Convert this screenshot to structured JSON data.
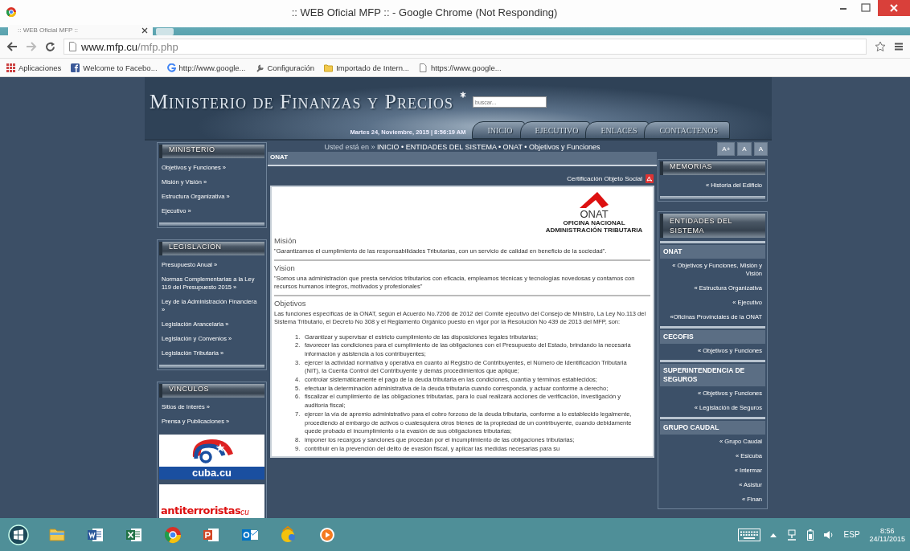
{
  "window": {
    "title": ":: WEB Oficial MFP :: - Google Chrome (Not Responding)"
  },
  "tabs": [
    {
      "label": ":: WEB Oficial MFP ::",
      "selected": true
    }
  ],
  "address": {
    "host": "www.mfp.cu",
    "path": "/mfp.php"
  },
  "bookmarks": [
    {
      "label": "Aplicaciones",
      "kind": "apps"
    },
    {
      "label": "Welcome to Facebo...",
      "kind": "facebook"
    },
    {
      "label": "http://www.google...",
      "kind": "google"
    },
    {
      "label": "Configuración",
      "kind": "tool"
    },
    {
      "label": "Importado de Intern...",
      "kind": "folder"
    },
    {
      "label": "https://www.google...",
      "kind": "page"
    }
  ],
  "header": {
    "title": "Ministerio de Finanzas y Precios",
    "search": {
      "placeholder": "buscar..."
    },
    "date": "Martes 24, Noviembre, 2015 | 8:56:19 AM",
    "nav": [
      "INICIO",
      "EJECUTIVO",
      "ENLACES",
      "CONTACTENOS"
    ]
  },
  "left_sidebar": [
    {
      "title": "MINISTERIO",
      "links": [
        "Objetivos y Funciones »",
        "Misión y Visión »",
        "Estructura Organizativa »",
        "Ejecutivo »"
      ]
    },
    {
      "title": "LEGISLACIÓN",
      "links": [
        "Presupuesto Anual »",
        "Normas Complementarias a la Ley 119 del Presupuesto 2015 »",
        "Ley de la Administración Financiera »",
        "Legislación Arancelaria »",
        "Legislación y Convenios »",
        "Legislación Tributaria »"
      ]
    },
    {
      "title": "VINCULOS",
      "links": [
        "Sitios de Interés »",
        "Prensa y Publicaciones »"
      ],
      "banners": [
        {
          "kind": "cuba",
          "text": "cuba.cu"
        },
        {
          "kind": "antiterroristas",
          "text": "antiterroristas",
          "suffix": "cu"
        }
      ]
    }
  ],
  "breadcrumb": {
    "label": "Usted está en »",
    "path": "INICIO • ENTIDADES DEL SISTEMA • ONAT • Objetivos y Funciones"
  },
  "font_buttons": [
    "A+",
    "A",
    "A"
  ],
  "content": {
    "title": "ONAT",
    "certificate_link": "Certificación Objeto Social",
    "logo": {
      "name": "ONAT",
      "subtitle": "OFICINA NACIONAL ADMINISTRACIÓN TRIBUTARIA"
    },
    "sections": [
      {
        "heading": "Misión",
        "text": "\"Garantizamos el cumplimiento de las responsabilidades Tributarias, con un servicio de calidad en beneficio de la sociedad\"."
      },
      {
        "heading": "Vision",
        "text": "\"Somos una administración que presta servicios tributarios con eficacia, empleamos técnicas y tecnologías novedosas y contamos con recursos humanos íntegros, motivados y profesionales\""
      },
      {
        "heading": "Objetivos",
        "text": "Las funciones específicas de la ONAT, según el Acuerdo No.7206 de 2012 del Comité ejecutivo del Consejo de Ministro, La Ley No.113 del Sistema Tributario, el Decreto No 308 y el Reglamento Orgánico puesto en vigor por la Resolución No 439 de 2013 del MFP, son:",
        "items": [
          {
            "number": "1.",
            "text": "Garantizar y supervisar el estricto cumplimiento de las disposiciones legales tributarias;"
          },
          {
            "number": "2.",
            "text": "favorecer las condiciones para el cumplimiento de las obligaciones con el Presupuesto del Estado, brindando la necesaria información y asistencia a los contribuyentes;"
          },
          {
            "number": "3.",
            "text": "ejercer la actividad normativa y operativa en cuanto al Registro de Contribuyentes, el Número de Identificación Tributaria (NIT), la Cuenta Control del Contribuyente y demás procedimientos que aplique;"
          },
          {
            "number": "4.",
            "text": "controlar sistemáticamente el pago de la deuda tributaria en las condiciones, cuantía y términos establecidos;"
          },
          {
            "number": "5.",
            "text": "efectuar la determinación administrativa de la deuda tributaria cuando corresponda, y actuar conforme a derecho;"
          },
          {
            "number": "6.",
            "text": "fiscalizar el cumplimiento de las obligaciones tributarias, para lo cual realizará acciones de verificación, investigación y auditoría fiscal;"
          },
          {
            "number": "7.",
            "text": "ejercer la vía de apremio administrativo para el cobro forzoso de la deuda tributaria, conforme a lo establecido legalmente, procediendo al embargo de activos o cualesquiera otros bienes de la propiedad de un contribuyente, cuando debidamente quede probado el incumplimiento o la evasión de sus obligaciones tributarias;"
          },
          {
            "number": "8.",
            "text": "imponer los recargos y sanciones que procedan por el incumplimiento de las obligaciones tributarias;"
          },
          {
            "number": "9.",
            "text": "contribuir en la prevención del delito de evasión fiscal, y aplicar las medidas necesarias para su"
          }
        ]
      }
    ]
  },
  "right_sidebar": {
    "memorias": {
      "title": "MEMORIAS",
      "links": [
        "« Historia del Edificio"
      ]
    },
    "entidades": {
      "title": "ENTIDADES DEL SISTEMA",
      "groups": [
        {
          "name": "ONAT",
          "links": [
            "« Objetivos y Funciones, Misión y Visión",
            "« Estructura Organizativa",
            "« Ejecutivo",
            "«Oficinas Provinciales de la ONAT"
          ]
        },
        {
          "name": "CECOFIS",
          "links": [
            "« Objetivos y Funciones"
          ]
        },
        {
          "name": "SUPERINTENDENCIA DE SEGUROS",
          "links": [
            "« Objetivos y Funciones",
            "« Legislación de Seguros"
          ]
        },
        {
          "name": "GRUPO CAUDAL",
          "links": [
            "« Grupo Caudal",
            "« Esicuba",
            "« Intermar",
            "« Asistur",
            "« Finan"
          ]
        }
      ]
    }
  },
  "taskbar": {
    "apps": [
      {
        "kind": "start"
      },
      {
        "kind": "explorer"
      },
      {
        "kind": "word"
      },
      {
        "kind": "excel"
      },
      {
        "kind": "chrome"
      },
      {
        "kind": "powerpoint"
      },
      {
        "kind": "outlook"
      },
      {
        "kind": "yellow-app"
      },
      {
        "kind": "orange-app"
      }
    ],
    "language": "ESP",
    "time": "8:56",
    "date": "24/11/2015"
  }
}
